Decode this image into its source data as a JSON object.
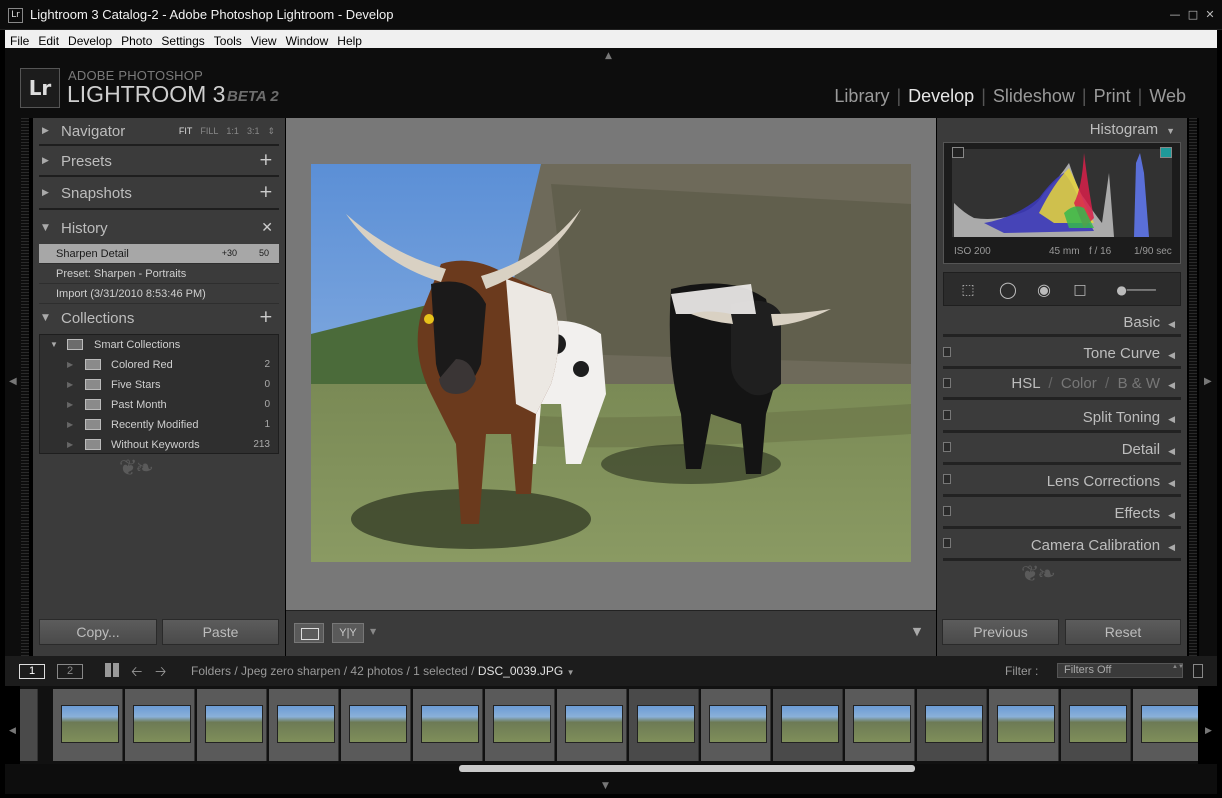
{
  "window": {
    "icon_text": "Lr",
    "title": "Lightroom 3 Catalog-2 - Adobe Photoshop Lightroom - Develop"
  },
  "menu": [
    "File",
    "Edit",
    "Develop",
    "Photo",
    "Settings",
    "Tools",
    "View",
    "Window",
    "Help"
  ],
  "brand": {
    "logo": "Lr",
    "line1": "ADOBE PHOTOSHOP",
    "line2": "LIGHTROOM 3",
    "tag": "BETA 2"
  },
  "modules": [
    {
      "label": "Library",
      "active": false
    },
    {
      "label": "Develop",
      "active": true
    },
    {
      "label": "Slideshow",
      "active": false
    },
    {
      "label": "Print",
      "active": false
    },
    {
      "label": "Web",
      "active": false
    }
  ],
  "left": {
    "navigator": {
      "label": "Navigator",
      "opts": [
        "FIT",
        "FILL",
        "1:1",
        "3:1"
      ]
    },
    "presets": {
      "label": "Presets"
    },
    "snapshots": {
      "label": "Snapshots"
    },
    "history": {
      "label": "History",
      "items": [
        {
          "label": "Sharpen Detail",
          "v1": "+30",
          "v2": "50",
          "selected": true
        },
        {
          "label": "Preset: Sharpen - Portraits",
          "v1": "",
          "v2": "",
          "selected": false
        },
        {
          "label": "Import (3/31/2010 8:53:46 PM)",
          "v1": "",
          "v2": "",
          "selected": false
        }
      ]
    },
    "collections": {
      "label": "Collections",
      "group": "Smart Collections",
      "items": [
        {
          "label": "Colored Red",
          "count": "2"
        },
        {
          "label": "Five Stars",
          "count": "0"
        },
        {
          "label": "Past Month",
          "count": "0"
        },
        {
          "label": "Recently Modified",
          "count": "1"
        },
        {
          "label": "Without Keywords",
          "count": "213"
        }
      ]
    },
    "copy_btn": "Copy...",
    "paste_btn": "Paste"
  },
  "toolbar": {
    "yy": "Y|Y"
  },
  "right": {
    "histogram_label": "Histogram",
    "meta": {
      "iso": "ISO 200",
      "focal": "45 mm",
      "aperture": "f / 16",
      "shutter": "1/90 sec"
    },
    "panels": {
      "basic": "Basic",
      "tone_curve": "Tone Curve",
      "hsl": "HSL",
      "color": "Color",
      "bw": "B & W",
      "split_toning": "Split Toning",
      "detail": "Detail",
      "lens": "Lens Corrections",
      "effects": "Effects",
      "calibration": "Camera Calibration"
    },
    "previous_btn": "Previous",
    "reset_btn": "Reset"
  },
  "filmstrip": {
    "view1": "1",
    "view2": "2",
    "path": "Folders / Jpeg zero sharpen / 42 photos / 1 selected /",
    "file": "DSC_0039.JPG",
    "filter_label": "Filter :",
    "filter_value": "Filters Off"
  },
  "colors": {
    "accent": "#e6e6e6",
    "panel": "#3b3b3b",
    "background": "#000000"
  }
}
